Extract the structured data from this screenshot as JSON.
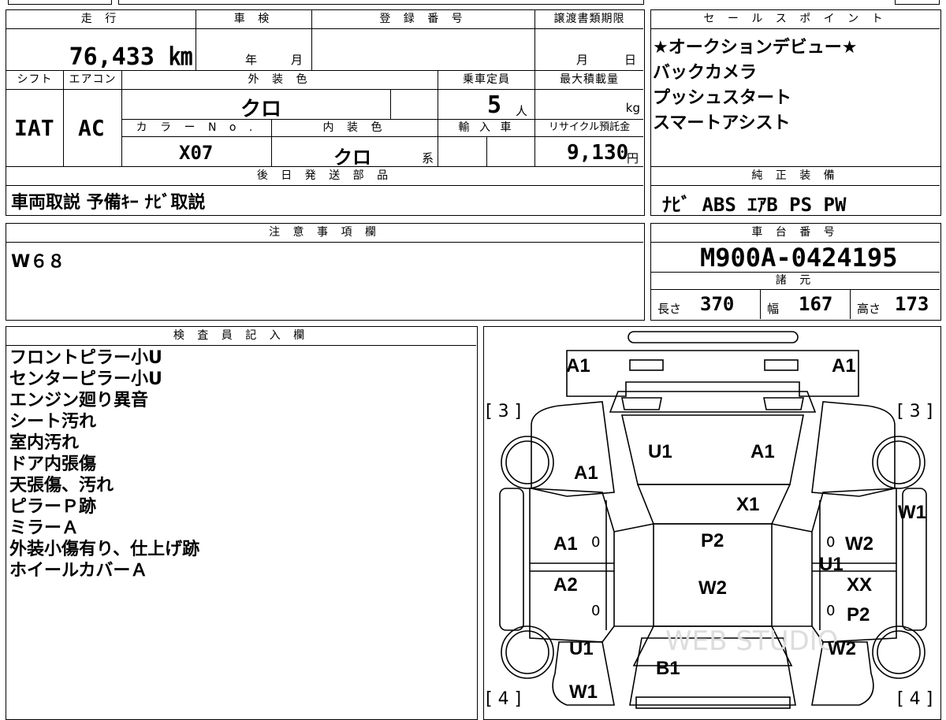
{
  "sheet": {
    "mileage_label": "走 行",
    "mileage_value": "76,433 ㎞",
    "inspection_label": "車 検",
    "inspection_year_unit": "年",
    "inspection_month_unit": "月",
    "registration_label": "登 録 番 号",
    "transfer_label": "譲渡書類期限",
    "transfer_month_unit": "月",
    "transfer_day_unit": "日",
    "shift_label": "シフト",
    "shift_value": "IAT",
    "ac_label": "エアコン",
    "ac_value": "AC",
    "exterior_color_label": "外 装 色",
    "exterior_color_value": "クロ",
    "capacity_label": "乗車定員",
    "capacity_value": "5",
    "capacity_unit": "人",
    "max_load_label": "最大積載量",
    "max_load_unit": "kg",
    "color_no_label": "カ ラ ー N o .",
    "color_no_value": "X07",
    "interior_color_label": "内 装 色",
    "interior_color_value": "クロ",
    "interior_color_unit": "系",
    "import_label": "輸 入 車",
    "recycle_label": "リサイクル預託金",
    "recycle_value": "9,130",
    "recycle_unit": "円",
    "later_parts_label": "後 日 発 送 部 品",
    "later_parts_value": "車両取説 予備ｷｰ ﾅﾋﾞ取説"
  },
  "sales_points": {
    "label": "セ ー ル ス ポ イ ン ト",
    "items": [
      "★オークションデビュー★",
      "バックカメラ",
      "プッシュスタート",
      "スマートアシスト"
    ]
  },
  "genuine_equipment": {
    "label": "純 正 装 備",
    "value": "ﾅﾋﾞ ABS ｴｱB PS PW"
  },
  "notes": {
    "label": "注 意 事 項 欄",
    "value": "W６８"
  },
  "chassis": {
    "label": "車 台 番 号",
    "value": "M900A-0424195",
    "specs_label": "諸 元",
    "length_label": "長さ",
    "length_value": "370",
    "width_label": "幅",
    "width_value": "167",
    "height_label": "高さ",
    "height_value": "173"
  },
  "inspector": {
    "label": "検 査 員 記 入 欄",
    "lines": [
      "フロントピラー小U",
      "センターピラー小U",
      "エンジン廻り異音",
      "シート汚れ",
      "室内汚れ",
      "ドア内張傷",
      "天張傷、汚れ",
      "ピラーＰ跡",
      "ミラーＡ",
      "外装小傷有り、仕上げ跡",
      "ホイールカバーＡ"
    ]
  },
  "diagram": {
    "tire_front_left": "[ 3 ]",
    "tire_front_right": "[ 3 ]",
    "tire_rear_left": "[ 4 ]",
    "tire_rear_right": "[ 4 ]",
    "marks": {
      "front_left": "A1",
      "front_right": "A1",
      "fender_left": "A1",
      "windshield_left": "U1",
      "windshield_right": "A1",
      "cowl": "X1",
      "pillar_right": "W1",
      "door_front_left": "A1",
      "door_rear_left": "A2",
      "roof": "P2",
      "roof_lower": "W2",
      "door_front_right": "W2",
      "door_front_right_2": "U1",
      "door_rear_right": "XX",
      "door_rear_right_2": "P2",
      "quarter_left": "U1",
      "quarter_right": "W2",
      "rear_left": "W1",
      "back_door": "B1",
      "zero_1": "0",
      "zero_2": "0",
      "zero_3": "0",
      "zero_4": "0"
    },
    "watermark": "WEB STUDIO"
  }
}
